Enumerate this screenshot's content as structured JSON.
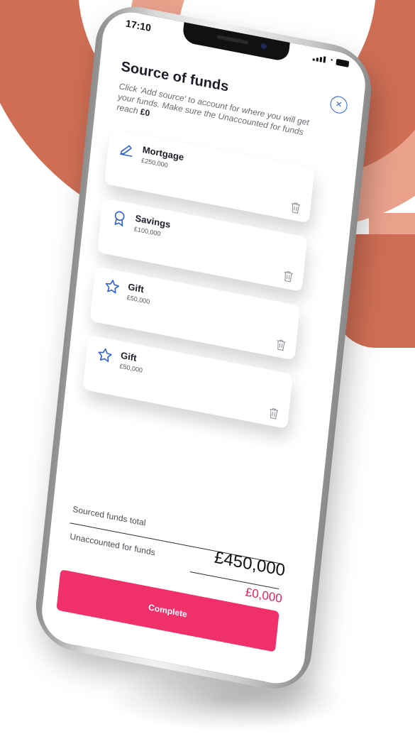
{
  "status": {
    "time": "17:10"
  },
  "header": {
    "title": "Source of funds",
    "close_glyph": "×",
    "subtitle": "Click 'Add source' to account for where you will get your funds. Make sure the Unaccounted for funds reach ",
    "subtitle_bold": "£0"
  },
  "sources": [
    {
      "name": "Mortgage",
      "amount": "£250,000",
      "icon": "edit-icon"
    },
    {
      "name": "Savings",
      "amount": "£100,000",
      "icon": "award-icon"
    },
    {
      "name": "Gift",
      "amount": "£50,000",
      "icon": "star-icon"
    },
    {
      "name": "Gift",
      "amount": "£50,000",
      "icon": "star-icon"
    }
  ],
  "summary": {
    "sourced_label": "Sourced funds total",
    "sourced_total": "£450,000",
    "unaccounted_label": "Unaccounted for funds",
    "unaccounted_value": "£0,000"
  },
  "actions": {
    "complete_label": "Complete"
  },
  "colors": {
    "accent_blue": "#2f5fd8",
    "primary_pink": "#f0306a",
    "background_ring": "#cf6e55",
    "background_ring_light": "#eaa28d"
  }
}
